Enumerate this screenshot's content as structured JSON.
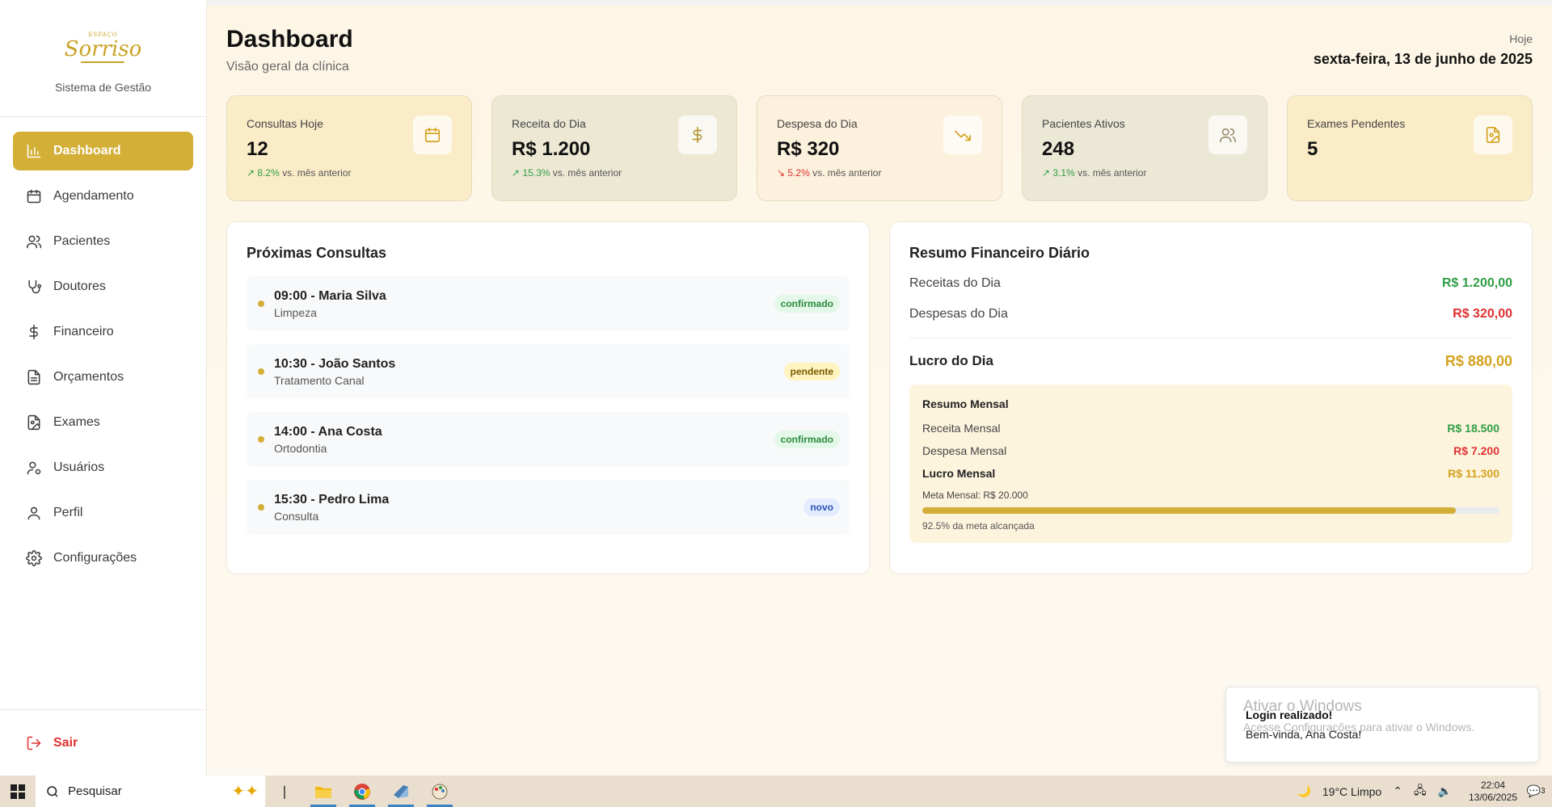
{
  "brand": {
    "logo_small": "ESPAÇO",
    "logo_main": "Sorriso",
    "subtitle": "Sistema de Gestão"
  },
  "nav": {
    "items": [
      {
        "label": "Dashboard",
        "icon": "bar-chart-icon",
        "active": true
      },
      {
        "label": "Agendamento",
        "icon": "calendar-icon"
      },
      {
        "label": "Pacientes",
        "icon": "users-icon"
      },
      {
        "label": "Doutores",
        "icon": "stethoscope-icon"
      },
      {
        "label": "Financeiro",
        "icon": "dollar-icon"
      },
      {
        "label": "Orçamentos",
        "icon": "document-icon"
      },
      {
        "label": "Exames",
        "icon": "file-image-icon"
      },
      {
        "label": "Usuários",
        "icon": "user-cog-icon"
      },
      {
        "label": "Perfil",
        "icon": "user-icon"
      },
      {
        "label": "Configurações",
        "icon": "gear-icon"
      }
    ],
    "logout": "Sair"
  },
  "header": {
    "title": "Dashboard",
    "subtitle": "Visão geral da clínica",
    "today_label": "Hoje",
    "today_date": "sexta-feira, 13 de junho de 2025"
  },
  "stats": [
    {
      "title": "Consultas Hoje",
      "value": "12",
      "trend": "↗ 8.2%",
      "trend_dir": "up",
      "trend_suffix": "vs. mês anterior",
      "icon": "calendar-icon",
      "bg": "#fbecc8",
      "icon_color": "#d4a21f"
    },
    {
      "title": "Receita do Dia",
      "value": "R$ 1.200",
      "trend": "↗ 15.3%",
      "trend_dir": "up",
      "trend_suffix": "vs. mês anterior",
      "icon": "dollar-icon",
      "bg": "#ece8d4",
      "icon_color": "#b79a3a"
    },
    {
      "title": "Despesa do Dia",
      "value": "R$ 320",
      "trend": "↘ 5.2%",
      "trend_dir": "down",
      "trend_suffix": "vs. mês anterior",
      "icon": "trending-down-icon",
      "bg": "#fcf1dc",
      "icon_color": "#d4a21f"
    },
    {
      "title": "Pacientes Ativos",
      "value": "248",
      "trend": "↗ 3.1%",
      "trend_dir": "up",
      "trend_suffix": "vs. mês anterior",
      "icon": "users-icon",
      "bg": "#ece8d6",
      "icon_color": "#9c8e6c"
    },
    {
      "title": "Exames Pendentes",
      "value": "5",
      "trend": "",
      "trend_dir": "",
      "trend_suffix": "",
      "icon": "file-image-icon",
      "bg": "#fbecc8",
      "icon_color": "#d4a21f"
    }
  ],
  "appointments": {
    "title": "Próximas Consultas",
    "items": [
      {
        "main": "09:00 - Maria Silva",
        "sub": "Limpeza",
        "status": "confirmado",
        "status_color": "green"
      },
      {
        "main": "10:30 - João Santos",
        "sub": "Tratamento Canal",
        "status": "pendente",
        "status_color": "yellow"
      },
      {
        "main": "14:00 - Ana Costa",
        "sub": "Ortodontia",
        "status": "confirmado",
        "status_color": "green"
      },
      {
        "main": "15:30 - Pedro Lima",
        "sub": "Consulta",
        "status": "novo",
        "status_color": "blue"
      }
    ]
  },
  "finance": {
    "title": "Resumo Financeiro Diário",
    "income_label": "Receitas do Dia",
    "income_value": "R$ 1.200,00",
    "expense_label": "Despesas do Dia",
    "expense_value": "R$ 320,00",
    "profit_label": "Lucro do Dia",
    "profit_value": "R$ 880,00",
    "monthly": {
      "title": "Resumo Mensal",
      "income_label": "Receita Mensal",
      "income_value": "R$ 18.500",
      "expense_label": "Despesa Mensal",
      "expense_value": "R$ 7.200",
      "profit_label": "Lucro Mensal",
      "profit_value": "R$ 11.300",
      "goal_label": "Meta Mensal: R$ 20.000",
      "progress_fraction": 0.925,
      "progress_text": "92.5% da meta alcançada"
    }
  },
  "toast": {
    "title": "Login realizado!",
    "message": "Bem-vinda, Ana Costa!"
  },
  "watermark": {
    "line1": "Ativar o Windows",
    "line2": "Acesse Configurações para ativar o Windows."
  },
  "taskbar": {
    "search_placeholder": "Pesquisar",
    "weather": "19°C  Limpo",
    "time": "22:04",
    "date": "13/06/2025",
    "notif_count": "3"
  }
}
